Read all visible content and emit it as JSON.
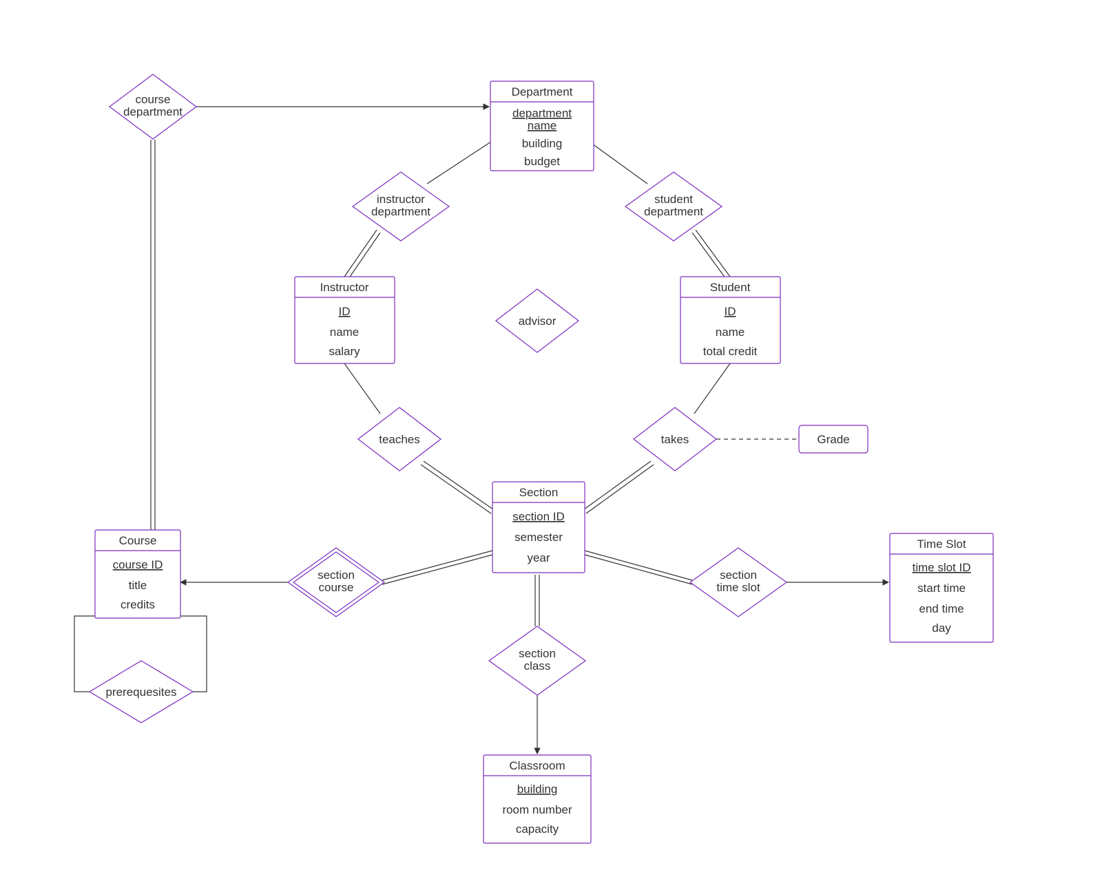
{
  "entities": {
    "department": {
      "title": "Department",
      "pk": "department name",
      "attrs": [
        "building",
        "budget"
      ]
    },
    "instructor": {
      "title": "Instructor",
      "pk": "ID",
      "attrs": [
        "name",
        "salary"
      ]
    },
    "student": {
      "title": "Student",
      "pk": "ID",
      "attrs": [
        "name",
        "total credit"
      ]
    },
    "section": {
      "title": "Section",
      "pk": "section ID",
      "attrs": [
        "semester",
        "year"
      ]
    },
    "course": {
      "title": "Course",
      "pk": "course ID",
      "attrs": [
        "title",
        "credits"
      ]
    },
    "classroom": {
      "title": "Classroom",
      "pk": "building",
      "attrs": [
        "room number",
        "capacity"
      ]
    },
    "timeslot": {
      "title": "Time Slot",
      "pk": "time slot ID",
      "attrs": [
        "start time",
        "end time",
        "day"
      ]
    },
    "grade": {
      "title": "Grade"
    }
  },
  "relationships": {
    "course_department": {
      "l1": "course",
      "l2": "department"
    },
    "instructor_department": {
      "l1": "instructor",
      "l2": "department"
    },
    "student_department": {
      "l1": "student",
      "l2": "department"
    },
    "advisor": {
      "l1": "advisor"
    },
    "teaches": {
      "l1": "teaches"
    },
    "takes": {
      "l1": "takes"
    },
    "section_course": {
      "l1": "section",
      "l2": "course"
    },
    "section_class": {
      "l1": "section",
      "l2": "class"
    },
    "section_time_slot": {
      "l1": "section",
      "l2": "time slot"
    },
    "prerequisites": {
      "l1": "prerequesites"
    }
  }
}
